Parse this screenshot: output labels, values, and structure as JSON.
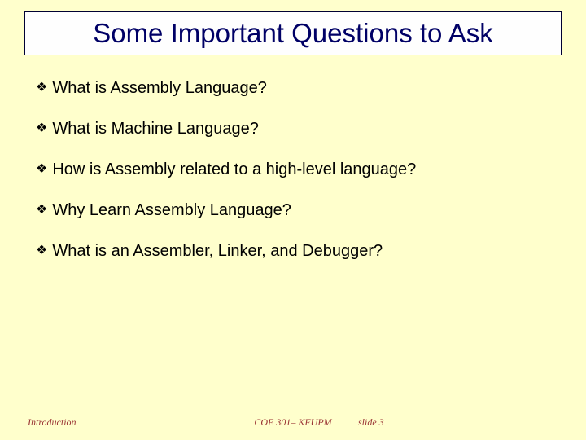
{
  "title": "Some Important Questions to Ask",
  "bullets": [
    "What is Assembly Language?",
    "What is Machine Language?",
    "How is Assembly related to a high-level language?",
    "Why Learn Assembly Language?",
    "What is an Assembler, Linker, and Debugger?"
  ],
  "footer": {
    "left": "Introduction",
    "center": "COE 301– KFUPM",
    "right": "slide 3"
  },
  "bullet_glyph": "❖"
}
